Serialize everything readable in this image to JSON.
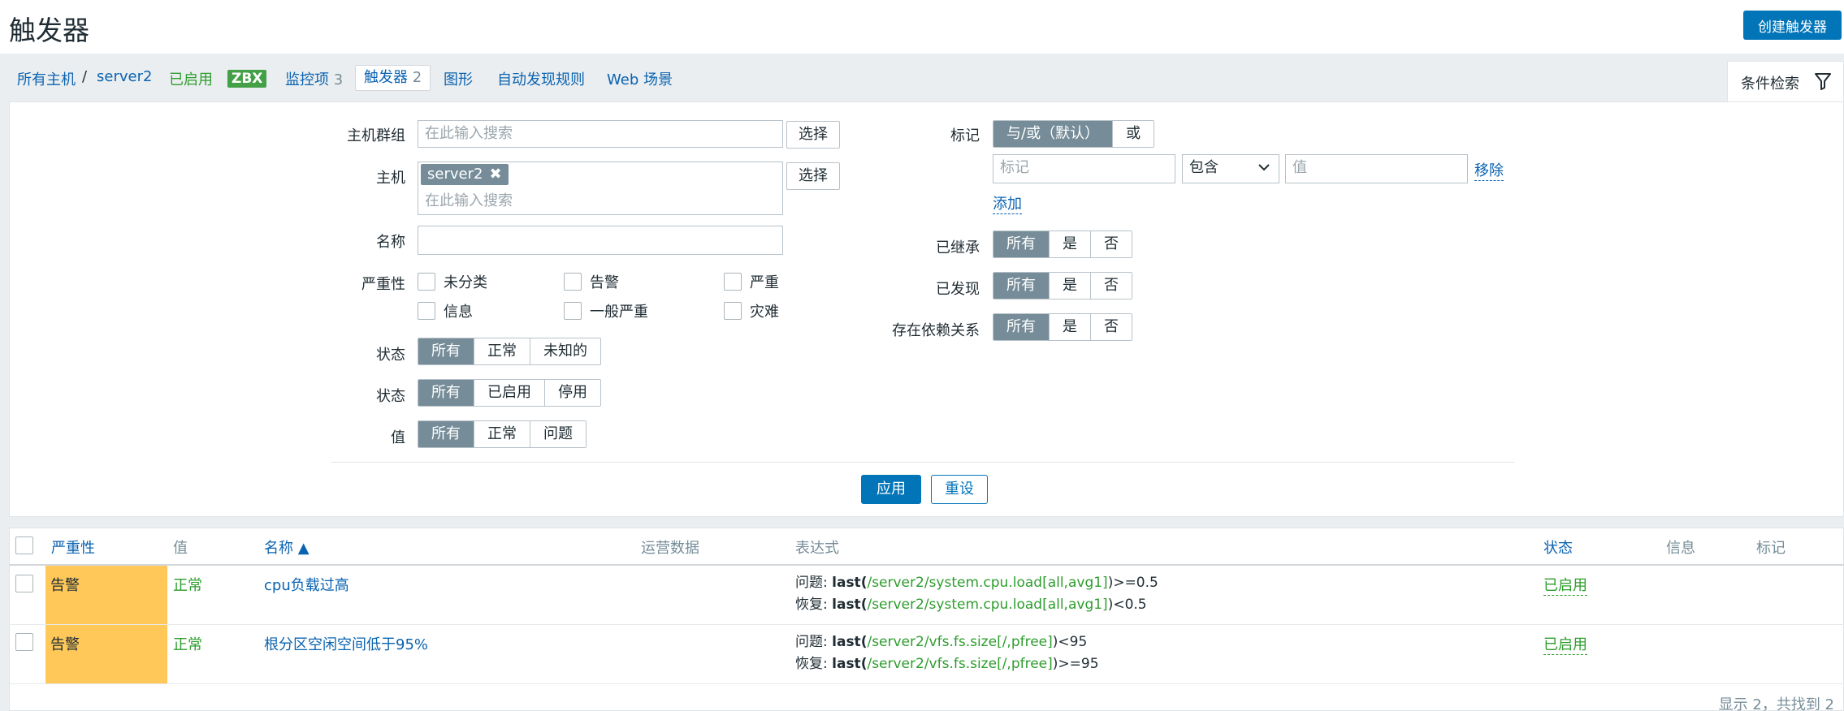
{
  "header": {
    "title": "触发器",
    "create_button": "创建触发器"
  },
  "breadcrumb": {
    "all_hosts": "所有主机",
    "separator": "/",
    "host": "server2",
    "enabled": "已启用",
    "zbx": "ZBX",
    "items_label": "监控项",
    "items_count": "3",
    "triggers_label": "触发器",
    "triggers_count": "2",
    "graphs": "图形",
    "discovery": "自动发现规则",
    "web": "Web 场景"
  },
  "filter": {
    "tab_label": "条件检索",
    "host_group_label": "主机群组",
    "host_group_placeholder": "在此输入搜索",
    "select_label": "选择",
    "host_label": "主机",
    "host_chip": "server2",
    "host_placeholder": "在此输入搜索",
    "name_label": "名称",
    "name_value": "",
    "severity_label": "严重性",
    "severities": [
      "未分类",
      "告警",
      "严重",
      "信息",
      "一般严重",
      "灾难"
    ],
    "state_label": "状态",
    "state_options": [
      "所有",
      "正常",
      "未知的"
    ],
    "status_label": "状态",
    "status_options": [
      "所有",
      "已启用",
      "停用"
    ],
    "value_label": "值",
    "value_options": [
      "所有",
      "正常",
      "问题"
    ],
    "tags_label": "标记",
    "tags_operator": [
      "与/或（默认）",
      "或"
    ],
    "tag_placeholder": "标记",
    "tag_condition": "包含",
    "tag_value_placeholder": "值",
    "remove_label": "移除",
    "add_label": "添加",
    "inherited_label": "已继承",
    "discovered_label": "已发现",
    "dependencies_label": "存在依赖关系",
    "yes_no_options": [
      "所有",
      "是",
      "否"
    ],
    "apply_label": "应用",
    "reset_label": "重设"
  },
  "table": {
    "columns": {
      "severity": "严重性",
      "value": "值",
      "name": "名称 ▲",
      "opdata": "运营数据",
      "expression": "表达式",
      "status": "状态",
      "info": "信息",
      "tags": "标记"
    },
    "rows": [
      {
        "severity": "告警",
        "value": "正常",
        "name": "cpu负载过高",
        "problem_prefix": "问题: ",
        "problem_fn": "last",
        "problem_open": "(",
        "problem_item": "/server2/system.cpu.load[all,avg1]",
        "problem_close": ")>=0.5",
        "recovery_prefix": "恢复: ",
        "recovery_fn": "last",
        "recovery_open": "(",
        "recovery_item": "/server2/system.cpu.load[all,avg1]",
        "recovery_close": ")<0.5",
        "status": "已启用"
      },
      {
        "severity": "告警",
        "value": "正常",
        "name": "根分区空闲空间低于95%",
        "problem_prefix": "问题: ",
        "problem_fn": "last",
        "problem_open": "(",
        "problem_item": "/server2/vfs.fs.size[/,pfree]",
        "problem_close": ")<95",
        "recovery_prefix": "恢复: ",
        "recovery_fn": "last",
        "recovery_open": "(",
        "recovery_item": "/server2/vfs.fs.size[/,pfree]",
        "recovery_close": ")>=95",
        "status": "已启用"
      }
    ],
    "footer": "显示 2，共找到 2"
  },
  "colors": {
    "accent": "#0275b8",
    "severity_warning": "#ffc859",
    "ok": "#2e9d2e",
    "segment_active": "#768d99"
  }
}
